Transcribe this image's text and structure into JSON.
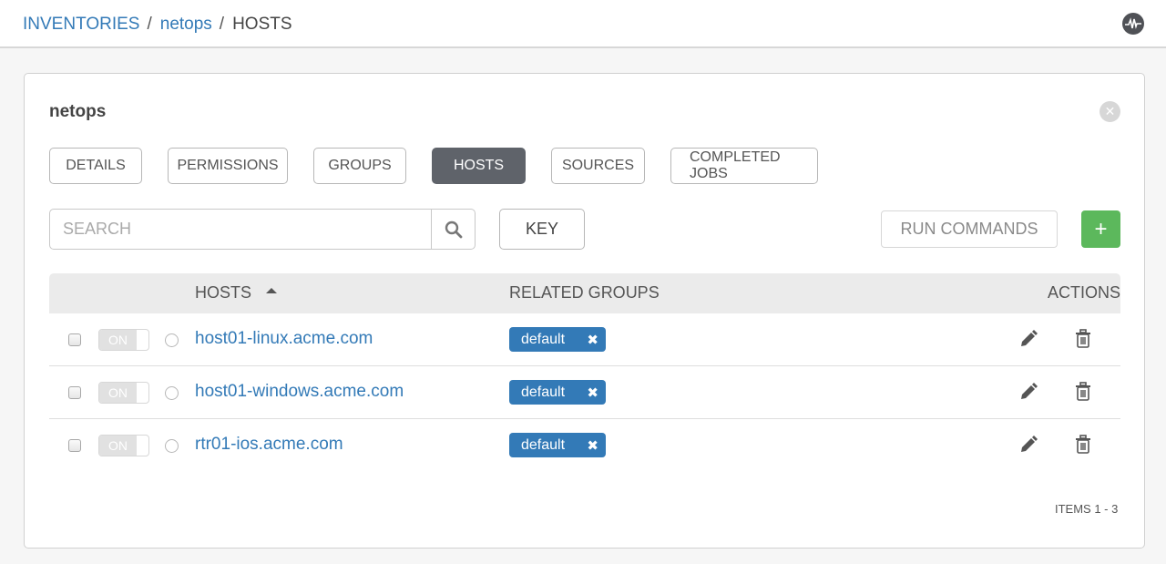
{
  "breadcrumb": {
    "items": [
      {
        "label": "INVENTORIES",
        "link": true
      },
      {
        "label": "netops",
        "link": true
      },
      {
        "label": "HOSTS",
        "link": false
      }
    ],
    "separator": "/"
  },
  "header": {
    "activity_icon": "activity-stream-icon"
  },
  "panel": {
    "title": "netops",
    "close_icon": "close-circle-icon",
    "tabs": [
      {
        "label": "DETAILS",
        "active": false
      },
      {
        "label": "PERMISSIONS",
        "active": false
      },
      {
        "label": "GROUPS",
        "active": false
      },
      {
        "label": "HOSTS",
        "active": true
      },
      {
        "label": "SOURCES",
        "active": false
      },
      {
        "label": "COMPLETED JOBS",
        "active": false
      }
    ],
    "search": {
      "placeholder": "SEARCH",
      "value": ""
    },
    "key_label": "KEY",
    "run_commands_label": "RUN COMMANDS",
    "add_label": "+",
    "table": {
      "columns": {
        "hosts": "HOSTS",
        "related_groups": "RELATED GROUPS",
        "actions": "ACTIONS"
      },
      "sort": {
        "column": "hosts",
        "direction": "ascending"
      },
      "rows": [
        {
          "host": "host01-linux.acme.com",
          "toggle": "ON",
          "group": "default",
          "group_remove": "✖"
        },
        {
          "host": "host01-windows.acme.com",
          "toggle": "ON",
          "group": "default",
          "group_remove": "✖"
        },
        {
          "host": "rtr01-ios.acme.com",
          "toggle": "ON",
          "group": "default",
          "group_remove": "✖"
        }
      ]
    },
    "items_count": "ITEMS  1 - 3"
  },
  "colors": {
    "link": "#337ab7",
    "active_tab": "#5f636a",
    "add_button": "#5cb85c",
    "tag": "#337ab7"
  }
}
